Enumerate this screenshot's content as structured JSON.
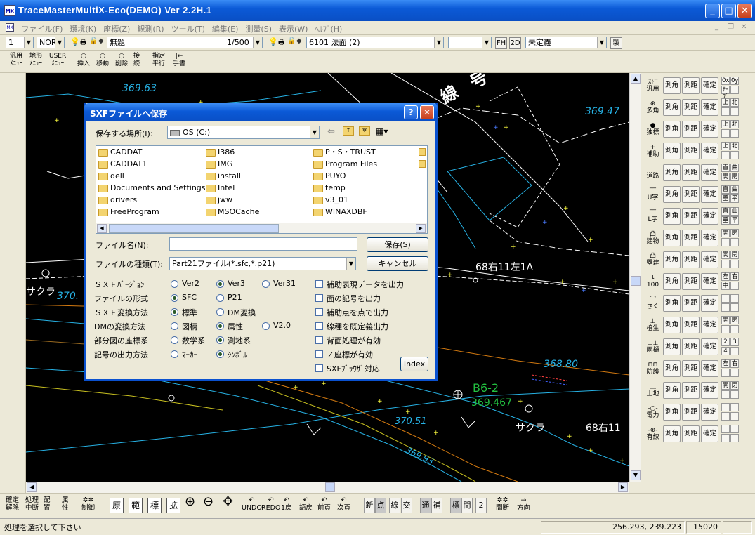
{
  "window": {
    "title": "TraceMasterMultiX-Eco(DEMO) Ver 2.2H.1",
    "icon": "MX"
  },
  "menu": [
    "ファイル(F)",
    "環境(K)",
    "座標(Z)",
    "観測(R)",
    "ツール(T)",
    "編集(E)",
    "測量(S)",
    "表示(W)",
    "ﾍﾙﾌﾟ(H)"
  ],
  "toolbar1": {
    "layer_num": "1",
    "mode": "NOR",
    "layer_name": "無題",
    "scale": "1/500",
    "code_name": "6101 法面 (2)",
    "empty_combo": "",
    "fh": "FH",
    "d2": "2D",
    "undefined_combo": "未定義",
    "make": "製"
  },
  "toolbar2": [
    {
      "l1": "汎用",
      "l2": "ﾒﾆｭｰ"
    },
    {
      "l1": "地形",
      "l2": "ﾒﾆｭｰ"
    },
    {
      "l1": "USER",
      "l2": "ﾒﾆｭｰ"
    },
    {
      "l1": "○",
      "l2": "挿入"
    },
    {
      "l1": "○",
      "l2": "移動"
    },
    {
      "l1": "○",
      "l2": "削除"
    },
    {
      "l1": "接",
      "l2": "続"
    },
    {
      "l1": "指定",
      "l2": "平行"
    },
    {
      "l1": "|←",
      "l2": "手書"
    }
  ],
  "map_labels": [
    {
      "text": "369.63",
      "color": "#27b3e6"
    },
    {
      "text": "369.47",
      "color": "#27b3e6"
    },
    {
      "text": "68右11左1A",
      "color": "#ffffff"
    },
    {
      "text": "サクラ",
      "color": "#ffffff"
    },
    {
      "text": "370.",
      "color": "#27b3e6"
    },
    {
      "text": "368.80",
      "color": "#27b3e6"
    },
    {
      "text": "B6-2",
      "color": "#22c040"
    },
    {
      "text": "369.467",
      "color": "#22c040"
    },
    {
      "text": "370.51",
      "color": "#27b3e6"
    },
    {
      "text": "サクラ",
      "color": "#ffffff"
    },
    {
      "text": "68右11",
      "color": "#ffffff"
    },
    {
      "text": "369.93",
      "color": "#27b3e6"
    },
    {
      "text": "線",
      "color": "#ffffff"
    },
    {
      "text": "号",
      "color": "#ffffff"
    }
  ],
  "dialog": {
    "title": "SXFファイルへ保存",
    "location_label": "保存する場所(I):",
    "location_value": "OS (C:)",
    "files": [
      [
        "CADDAT",
        "CADDAT1",
        "dell",
        "Documents and Settings",
        "drivers",
        "FreeProgram"
      ],
      [
        "I386",
        "IMG",
        "install",
        "Intel",
        "jww",
        "MSOCache"
      ],
      [
        "P・S・TRUST",
        "Program Files",
        "PUYO",
        "temp",
        "v3_01",
        "WINAXDBF"
      ]
    ],
    "filename_label": "ファイル名(N):",
    "filename_value": "",
    "filetype_label": "ファイルの種類(T):",
    "filetype_value": "Part21ファイル(*.sfc,*.p21)",
    "save_button": "保存(S)",
    "cancel_button": "キャンセル",
    "options": [
      {
        "label": "ＳＸＦﾊﾞｰｼﾞｮﾝ",
        "choices": [
          "Ver2",
          "Ver3",
          "Ver31"
        ],
        "selected": 1
      },
      {
        "label": "ファイルの形式",
        "choices": [
          "SFC",
          "P21"
        ],
        "selected": 0
      },
      {
        "label": "ＳＸＦ変換方法",
        "choices": [
          "標準",
          "DM変換"
        ],
        "selected": 0
      },
      {
        "label": "DMの変換方法",
        "choices": [
          "図柄",
          "属性",
          "V2.0"
        ],
        "selected": 1
      },
      {
        "label": "部分図の座標系",
        "choices": [
          "数学系",
          "測地系"
        ],
        "selected": 1
      },
      {
        "label": "記号の出力方法",
        "choices": [
          "ﾏｰｶｰ",
          "ｼﾝﾎﾞﾙ"
        ],
        "selected": 1
      }
    ],
    "checkboxes": [
      "補助表現データを出力",
      "面の記号を出力",
      "補助点を点で出力",
      "線種を既定義出力",
      "背面処理が有効",
      "Ｚ座標が有効",
      "SXFﾌﾞﾗｳｻﾞ対応"
    ],
    "index_button": "Index"
  },
  "palette": [
    {
      "icon1": "ｽﾄ‾",
      "icon2": "汎用",
      "b": [
        "測角",
        "測距",
        "確定"
      ],
      "extra": [
        "0x",
        "0y",
        "ﾃｰﾌﾞ",
        ""
      ]
    },
    {
      "icon1": "⊕",
      "icon2": "多角",
      "b": [
        "測角",
        "測距",
        "確定"
      ],
      "extra": [
        "上",
        "北",
        "",
        ""
      ]
    },
    {
      "icon1": "●",
      "icon2": "独標",
      "b": [
        "測角",
        "測距",
        "確定"
      ],
      "extra": [
        "上",
        "北",
        "",
        ""
      ]
    },
    {
      "icon1": "+",
      "icon2": "補助",
      "b": [
        "測角",
        "測距",
        "確定"
      ],
      "extra": [
        "上",
        "北",
        "",
        ""
      ]
    },
    {
      "icon1": "＿",
      "icon2": "道路",
      "b": [
        "測角",
        "測距",
        "確定"
      ],
      "extra": [
        "直",
        "曲",
        "開",
        "閉"
      ]
    },
    {
      "icon1": "‾‾",
      "icon2": "U字",
      "b": [
        "測角",
        "測距",
        "確定"
      ],
      "extra": [
        "直",
        "曲",
        "垂",
        "平"
      ]
    },
    {
      "icon1": "‾‾",
      "icon2": "L字",
      "b": [
        "測角",
        "測距",
        "確定"
      ],
      "extra": [
        "直",
        "曲",
        "垂",
        "平"
      ]
    },
    {
      "icon1": "凸",
      "icon2": "建物",
      "b": [
        "測角",
        "測距",
        "確定"
      ],
      "extra": [
        "開",
        "閉",
        "",
        ""
      ]
    },
    {
      "icon1": "凸",
      "icon2": "堅建",
      "b": [
        "測角",
        "測距",
        "確定"
      ],
      "extra": [
        "開",
        "閉",
        "",
        ""
      ]
    },
    {
      "icon1": "⇂",
      "icon2": "100",
      "b": [
        "測角",
        "測距",
        "確定"
      ],
      "extra": [
        "左",
        "右",
        "中",
        ""
      ]
    },
    {
      "icon1": "⌒",
      "icon2": "さく",
      "b": [
        "測角",
        "測距",
        "確定"
      ],
      "extra": [
        "",
        "",
        "",
        ""
      ]
    },
    {
      "icon1": "⊥",
      "icon2": "植生",
      "b": [
        "測角",
        "測距",
        "確定"
      ],
      "extra": [
        "開",
        "閉",
        "",
        ""
      ]
    },
    {
      "icon1": "⊥⊥",
      "icon2": "雨樋",
      "b": [
        "測角",
        "測距",
        "確定"
      ],
      "extra": [
        "2",
        "3",
        "4",
        ""
      ]
    },
    {
      "icon1": "⊓⊓",
      "icon2": "防護",
      "b": [
        "測角",
        "測距",
        "確定"
      ],
      "extra": [
        "左",
        "右",
        "",
        ""
      ]
    },
    {
      "icon1": "＿",
      "icon2": "土地",
      "b": [
        "測角",
        "測距",
        "確定"
      ],
      "extra": [
        "開",
        "閉",
        "",
        ""
      ]
    },
    {
      "icon1": "-○-",
      "icon2": "電力",
      "b": [
        "測角",
        "測距",
        "確定"
      ],
      "extra": [
        "",
        "",
        "",
        ""
      ]
    },
    {
      "icon1": "-⊕-",
      "icon2": "有線",
      "b": [
        "測角",
        "測距",
        "確定"
      ],
      "extra": [
        "",
        "",
        "",
        ""
      ]
    }
  ],
  "bottombar": {
    "left": [
      {
        "l1": "確定",
        "l2": "解除"
      },
      {
        "l1": "処理",
        "l2": "中断"
      },
      {
        "l1": "配",
        "l2": "置"
      },
      {
        "l1": "属",
        "l2": "性"
      },
      {
        "l1": "✲✲",
        "l2": "制御"
      }
    ],
    "boxes": [
      "原",
      "範",
      "標",
      "拡"
    ],
    "tools": [
      "UNDO",
      "REDO",
      "1戻",
      "語戻",
      "前頁",
      "次頁"
    ],
    "modes": [
      "新",
      "点",
      "線",
      "交",
      "通",
      "補",
      "標",
      "間",
      "2"
    ],
    "right": [
      {
        "l1": "✲✲",
        "l2": "間断"
      },
      {
        "l1": "→",
        "l2": "方向"
      }
    ]
  },
  "status": {
    "message": "処理を選択して下さい",
    "coords": "256.293,      239.223",
    "zoom": "15020"
  }
}
